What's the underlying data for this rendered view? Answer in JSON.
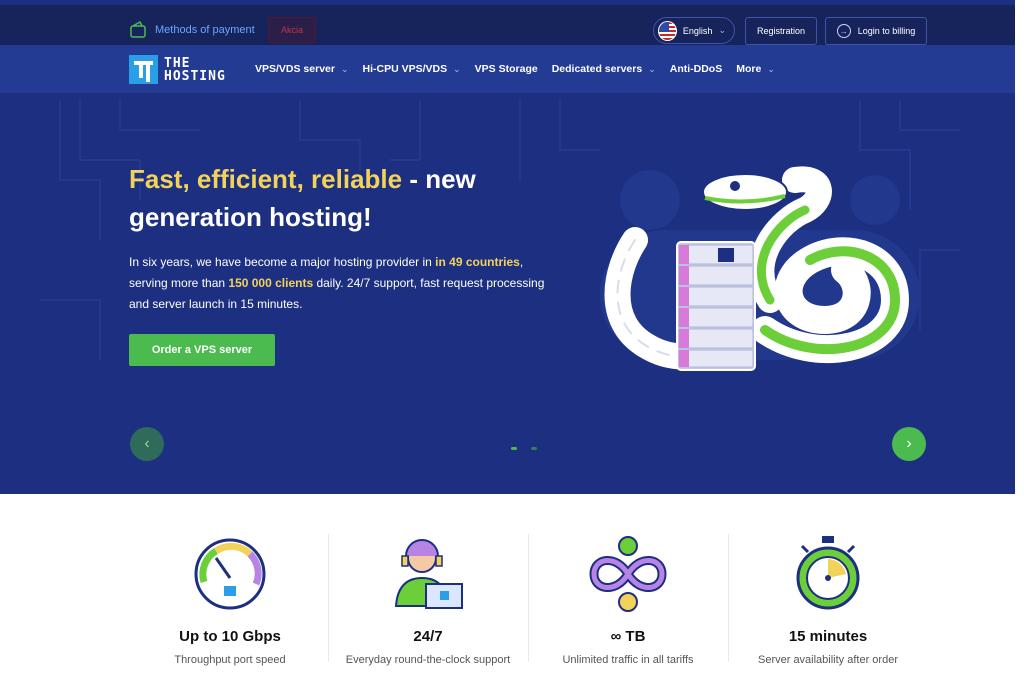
{
  "topbar": {
    "payment_label": "Methods of payment",
    "promo_label": "Akcia",
    "language_label": "English",
    "registration_label": "Registration",
    "login_label": "Login to billing"
  },
  "logo": {
    "line1": "THE",
    "line2": "HOSTING"
  },
  "nav": {
    "items": [
      {
        "label": "VPS/VDS server",
        "has_dropdown": true
      },
      {
        "label": "Hi-CPU VPS/VDS",
        "has_dropdown": true
      },
      {
        "label": "VPS Storage",
        "has_dropdown": false
      },
      {
        "label": "Dedicated servers",
        "has_dropdown": true
      },
      {
        "label": "Anti-DDoS",
        "has_dropdown": false
      },
      {
        "label": "More",
        "has_dropdown": true
      }
    ]
  },
  "hero": {
    "headline_highlight": "Fast, efficient, reliable",
    "headline_rest": " - new generation hosting!",
    "lead_part1": "In six years, we have become a major hosting provider in ",
    "lead_countries": "in 49 countries",
    "lead_part2": ", serving more than ",
    "lead_clients": "150 000 clients",
    "lead_part3": " daily. 24/7 support, fast request processing and server launch in 15 minutes.",
    "cta_label": "Order a VPS server",
    "prev_icon": "‹",
    "next_icon": "›"
  },
  "features": [
    {
      "title": "Up to 10 Gbps",
      "desc": "Throughput port speed",
      "icon": "speedometer-icon"
    },
    {
      "title": "24/7",
      "desc": "Everyday round-the-clock support",
      "icon": "support-agent-icon"
    },
    {
      "title": "∞ TB",
      "desc": "Unlimited traffic in all tariffs",
      "icon": "infinity-icon"
    },
    {
      "title": "15 minutes",
      "desc": "Server availability after order",
      "icon": "stopwatch-icon"
    }
  ],
  "colors": {
    "hero_bg": "#1d2f80",
    "topbar_bg": "#17245c",
    "nav_bg": "#233b93",
    "accent_yellow": "#f3d25a",
    "accent_green": "#4cbb4f"
  }
}
